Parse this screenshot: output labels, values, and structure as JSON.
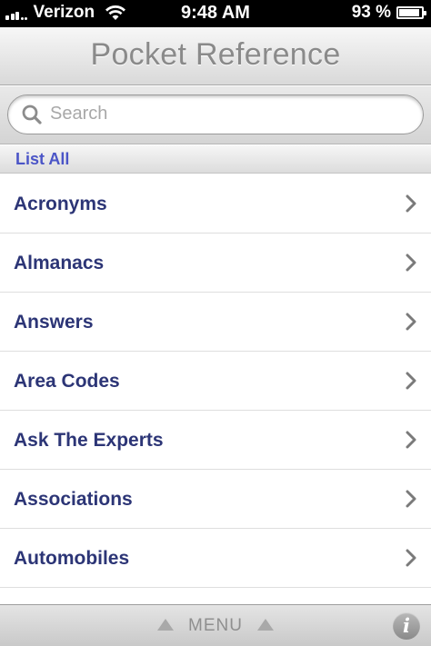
{
  "status_bar": {
    "carrier": "Verizon",
    "time": "9:48 AM",
    "battery": "93 %",
    "battery_level": 0.93
  },
  "title_bar": {
    "title": "Pocket Reference"
  },
  "search": {
    "placeholder": "Search"
  },
  "section": {
    "label": "List All"
  },
  "list": {
    "items": [
      {
        "label": "Acronyms"
      },
      {
        "label": "Almanacs"
      },
      {
        "label": "Answers"
      },
      {
        "label": "Area Codes"
      },
      {
        "label": "Ask The Experts"
      },
      {
        "label": "Associations"
      },
      {
        "label": "Automobiles"
      }
    ]
  },
  "bottom_bar": {
    "menu_label": "MENU",
    "info_label": "i"
  },
  "colors": {
    "section_label": "#4b55c7",
    "item_label": "#2c3576",
    "title_text": "#8a8a8a"
  }
}
